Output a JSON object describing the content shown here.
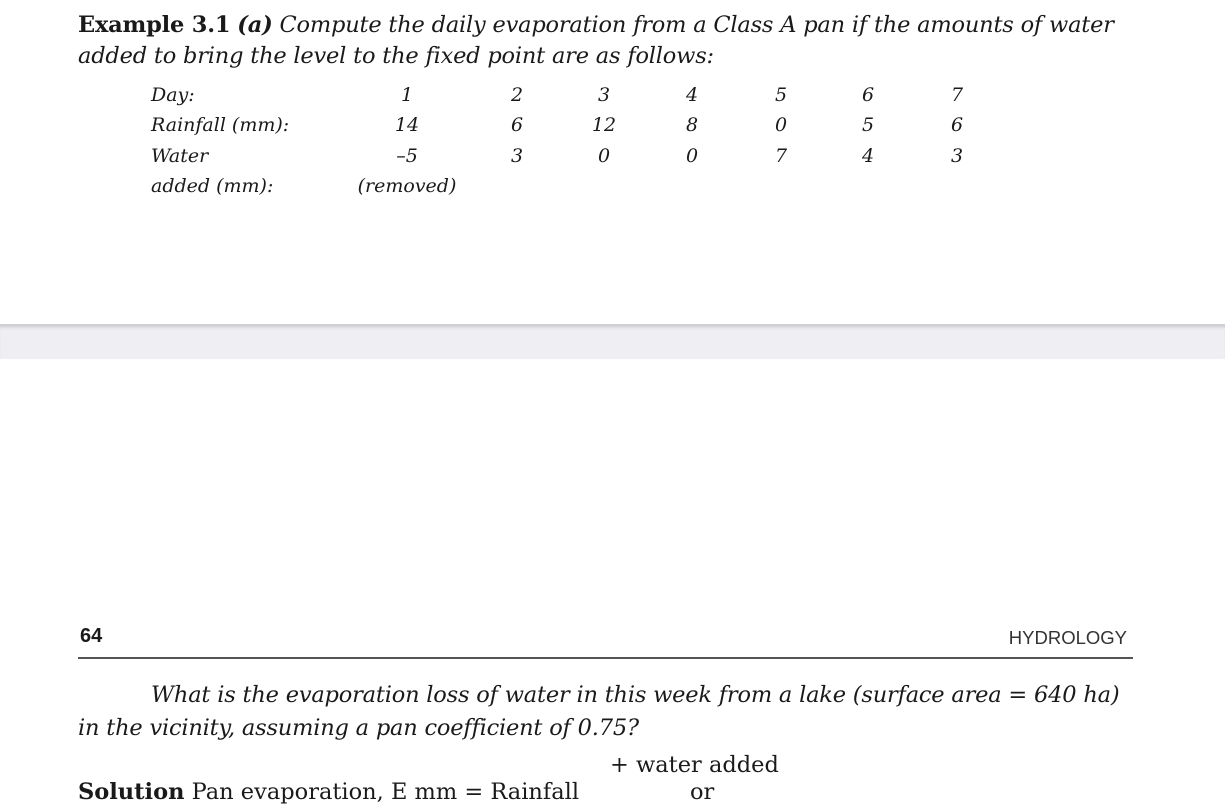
{
  "example": {
    "label": "Example 3.1",
    "part": "(a)",
    "text": "Compute the daily evaporation from a Class A pan if the amounts of water added to bring the level to the fixed point are as follows:"
  },
  "table": {
    "row_labels": [
      "Day:",
      "Rainfall (mm):",
      "Water",
      "added (mm):"
    ],
    "days": [
      "1",
      "2",
      "3",
      "4",
      "5",
      "6",
      "7"
    ],
    "rainfall_mm": [
      "14",
      "6",
      "12",
      "8",
      "0",
      "5",
      "6"
    ],
    "water_added_mm": [
      "–5",
      "3",
      "0",
      "0",
      "7",
      "4",
      "3"
    ],
    "note_day1": "(removed)"
  },
  "running_head": {
    "page_number": "64",
    "book_title": "HYDROLOGY"
  },
  "question": {
    "text": "What is the evaporation loss of water in this week from a lake (surface area = 640 ha) in the vicinity, assuming a pan coefficient of 0.75?"
  },
  "solution": {
    "water_added_fragment": "+ water added",
    "label": "Solution",
    "text": "Pan evaporation, E  mm = Rainfall",
    "or_text": "or"
  }
}
